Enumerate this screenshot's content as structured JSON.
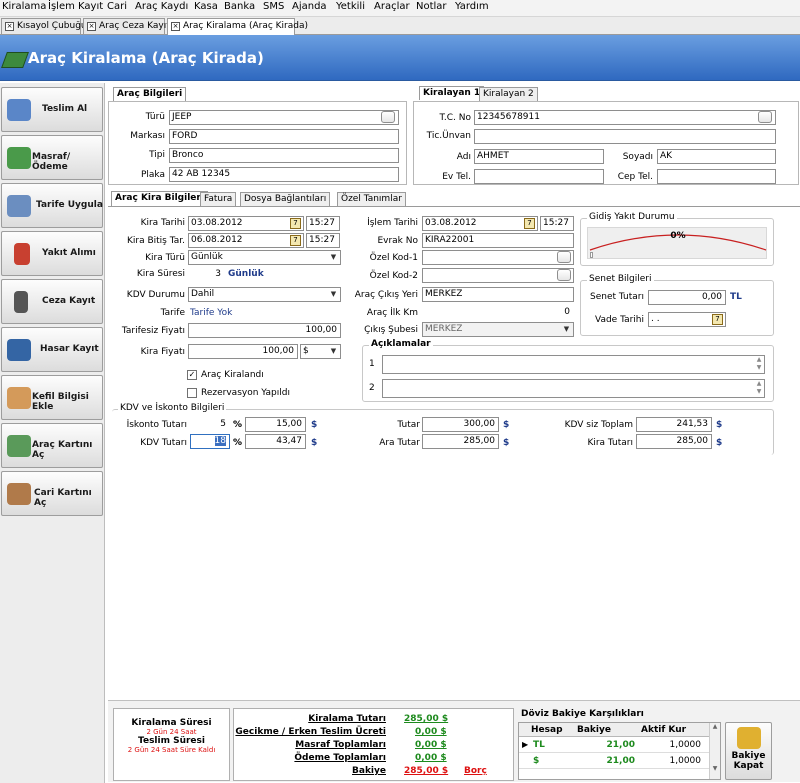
{
  "menu": [
    "Kiralama",
    "İşlem Kayıt",
    "Cari",
    "Araç Kaydı",
    "Kasa",
    "Banka",
    "SMS",
    "Ajanda",
    "Yetkili",
    "Araçlar",
    "Notlar",
    "Yardım"
  ],
  "doc_tabs": [
    "Kısayol Çubuğu",
    "Araç Ceza Kayıt",
    "Araç Kiralama (Araç Kirada)"
  ],
  "header": {
    "title": "Araç Kiralama (Araç Kirada)"
  },
  "sidebar": [
    "Teslim Al",
    "Masraf/Ödeme",
    "Tarife Uygula",
    "Yakıt Alımı",
    "Ceza Kayıt",
    "Hasar Kayıt",
    "Kefil Bilgisi Ekle",
    "Araç Kartını Aç",
    "Cari Kartını Aç"
  ],
  "vehicle": {
    "tab": "Araç Bilgileri",
    "turu_label": "Türü",
    "turu": "JEEP",
    "marka_label": "Markası",
    "marka": "FORD",
    "tipi_label": "Tipi",
    "tipi": "Bronco",
    "plaka_label": "Plaka",
    "plaka": "42 AB 12345"
  },
  "renter": {
    "tab1": "Kiralayan 1",
    "tab2": "Kiralayan 2",
    "tc_label": "T.C. No",
    "tc": "12345678911",
    "unvan_label": "Tic.Ünvan",
    "unvan": "",
    "adi_label": "Adı",
    "adi": "AHMET",
    "soyadi_label": "Soyadı",
    "soyadi": "AK",
    "evtel_label": "Ev Tel.",
    "evtel": "",
    "ceptel_label": "Cep Tel.",
    "ceptel": ""
  },
  "tabs": [
    "Araç Kira Bilgileri",
    "Fatura",
    "Dosya Bağlantıları",
    "Özel Tanımlar"
  ],
  "rent": {
    "kira_tarihi_label": "Kira Tarihi",
    "kira_tarihi": "03.08.2012",
    "kira_saati": "15:27",
    "bitis_label": "Kira Bitiş Tar.",
    "bitis_tarihi": "06.08.2012",
    "bitis_saati": "15:27",
    "turu_label": "Kira Türü",
    "turu": "Günlük",
    "suresi_label": "Kira Süresi",
    "suresi": "3",
    "suresi_unit": "Günlük",
    "kdv_durumu_label": "KDV Durumu",
    "kdv_durumu": "Dahil",
    "tarife_label": "Tarife",
    "tarife": "Tarife Yok",
    "tarifesiz_label": "Tarifesiz Fiyatı",
    "tarifesiz": "100,00",
    "kira_fiyati_label": "Kira Fiyatı",
    "kira_fiyati": "100,00",
    "currency": "$",
    "arac_kiralandi": "Araç Kiralandı",
    "rezervasyon": "Rezervasyon Yapıldı"
  },
  "islem": {
    "tarih_label": "İşlem Tarihi",
    "tarih": "03.08.2012",
    "saat": "15:27",
    "evrak_label": "Evrak No",
    "evrak": "KIRA22001",
    "ozel1_label": "Özel Kod-1",
    "ozel2_label": "Özel Kod-2",
    "cikis_yeri_label": "Araç Çıkış Yeri",
    "cikis_yeri": "MERKEZ",
    "ilk_km_label": "Araç İlk Km",
    "ilk_km": "0",
    "sube_label": "Çıkış Şubesi",
    "sube": "MERKEZ"
  },
  "fuel": {
    "title": "Gidiş Yakıt Durumu",
    "value": "0%",
    "pct": 0
  },
  "senet": {
    "title": "Senet Bilgileri",
    "tutar_label": "Senet Tutarı",
    "tutar": "0,00",
    "tutar_unit": "TL",
    "vade_label": "Vade Tarihi",
    "vade": ". ."
  },
  "aciklama": {
    "title": "Açıklamalar",
    "row1": "1",
    "row2": "2"
  },
  "kdv": {
    "title": "KDV ve İskonto Bilgileri",
    "iskonto_label": "İskonto Tutarı",
    "iskonto_pct": "5",
    "iskonto": "15,00",
    "kdv_label": "KDV Tutarı",
    "kdv_pct": "18",
    "kdv": "43,47",
    "tutar_label": "Tutar",
    "tutar": "300,00",
    "ara_label": "Ara Tutar",
    "ara": "285,00",
    "kdvsiz_label": "KDV siz Toplam",
    "kdvsiz": "241,53",
    "kira_tutari_label": "Kira Tutarı",
    "kira_tutari": "285,00",
    "pct_sign": "%",
    "dollar": "$"
  },
  "footer": {
    "kiralama_suresi_label": "Kiralama Süresi",
    "kiralama_suresi": "2 Gün 24 Saat",
    "teslim_suresi_label": "Teslim Süresi",
    "teslim_suresi": "2 Gün 24 Saat  Süre Kaldı",
    "kiralama_tutari_label": "Kiralama Tutarı",
    "kiralama_tutari": "285,00 $",
    "gecikme_label": "Gecikme / Erken Teslim Ücreti",
    "gecikme": "0,00 $",
    "masraf_label": "Masraf Toplamları",
    "masraf": "0,00 $",
    "odeme_label": "Ödeme Toplamları",
    "odeme": "0,00 $",
    "bakiye_label": "Bakiye",
    "bakiye": "285,00 $",
    "borc": "Borç"
  },
  "doviz": {
    "title": "Döviz Bakiye Karşılıkları",
    "headers": [
      "Hesap",
      "Bakiye",
      "Aktif Kur"
    ],
    "rows": [
      {
        "hesap": "TL",
        "bakiye": "21,00",
        "kur": "1,0000"
      },
      {
        "hesap": "$",
        "bakiye": "21,00",
        "kur": "1,0000"
      }
    ]
  },
  "bakiye_kapat": "Bakiye Kapat"
}
